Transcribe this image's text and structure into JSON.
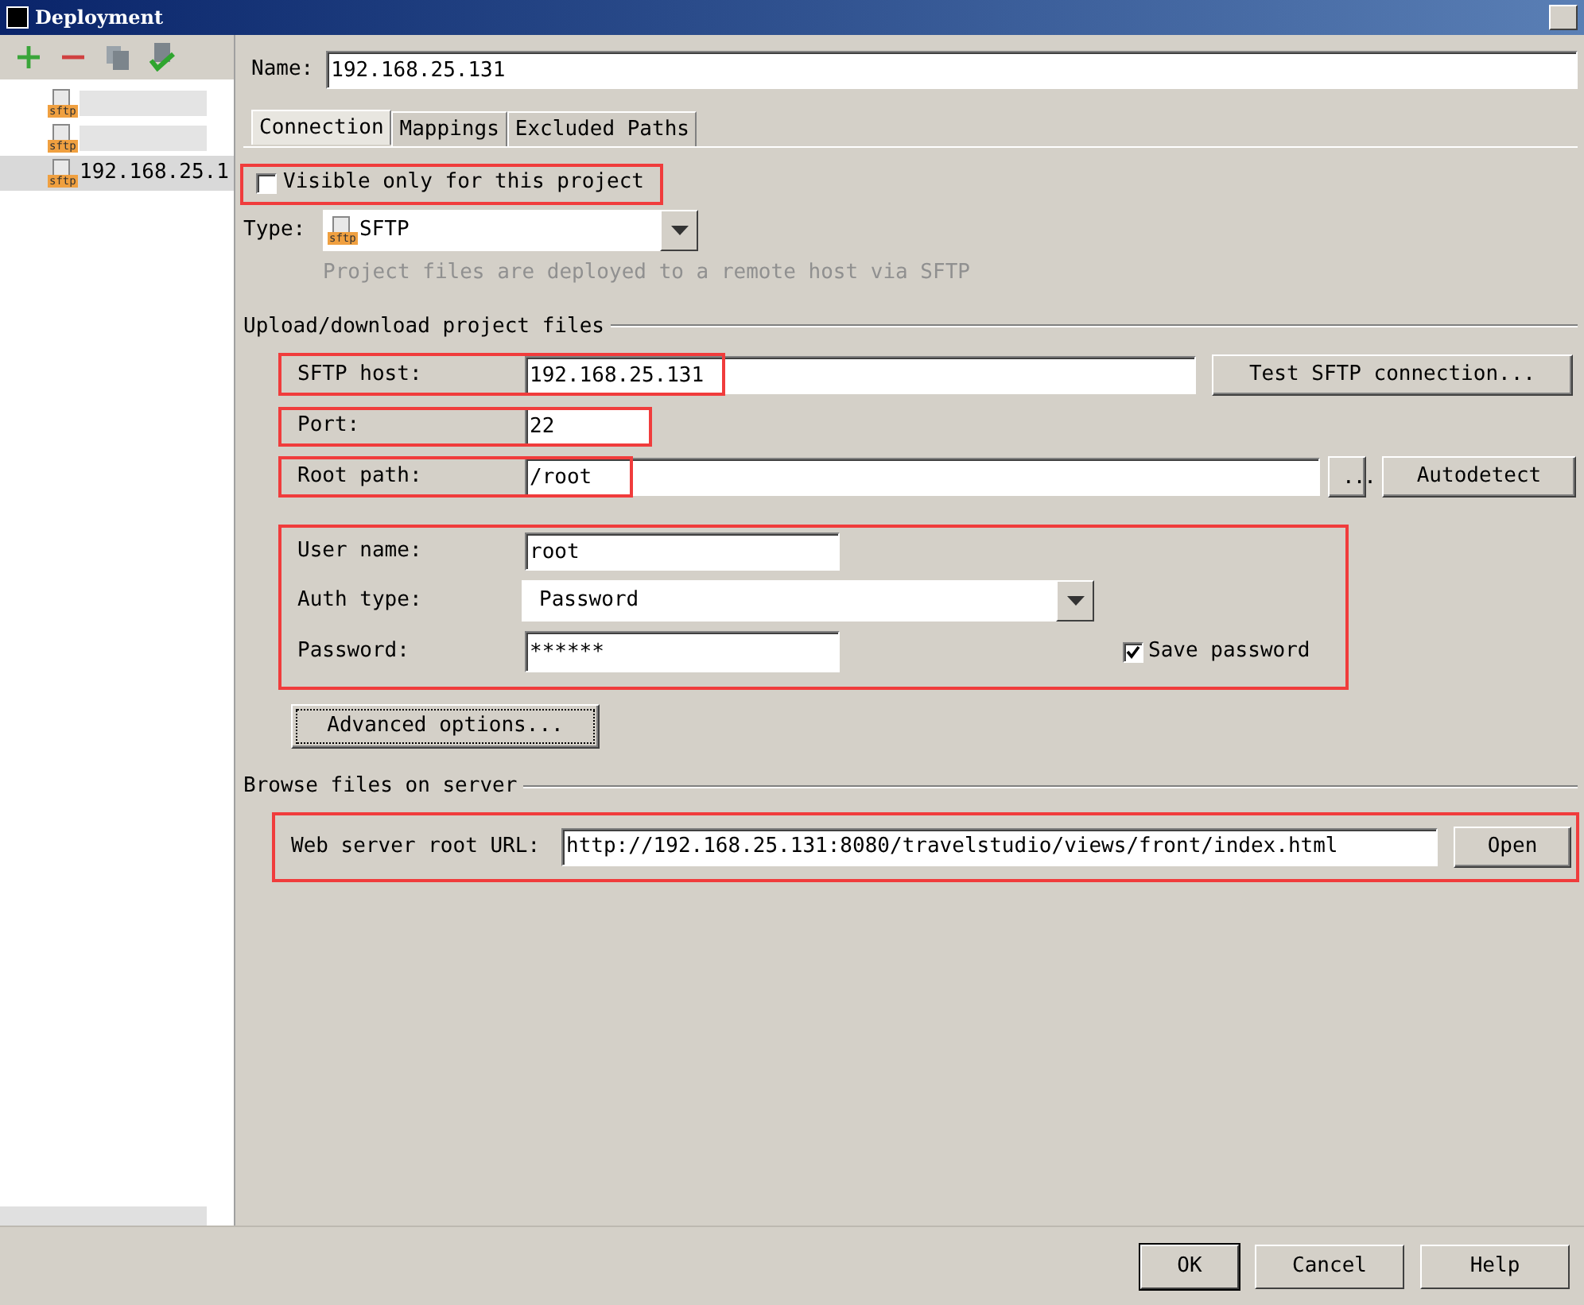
{
  "window": {
    "title": "Deployment"
  },
  "tree": [
    {
      "kind": "blurred",
      "icon_label": "sftp",
      "selected": false
    },
    {
      "kind": "blurred",
      "icon_label": "sftp",
      "selected": false
    },
    {
      "kind": "server",
      "icon_label": "sftp",
      "label": "192.168.25.1",
      "selected": true
    }
  ],
  "name": {
    "label": "Name:",
    "value": "192.168.25.131"
  },
  "tabs": [
    {
      "label": "Connection",
      "selected": true
    },
    {
      "label": "Mappings",
      "selected": false
    },
    {
      "label": "Excluded Paths",
      "selected": false
    }
  ],
  "visible_only": {
    "label": "Visible only for this project",
    "checked": false,
    "highlighted": true
  },
  "type": {
    "label": "Type:",
    "icon_label": "sftp",
    "value": "SFTP",
    "description": "Project files are deployed to a remote host via SFTP"
  },
  "upload_section": {
    "title": "Upload/download project files",
    "host": {
      "label": "SFTP host:",
      "value": "192.168.25.131",
      "button": "Test SFTP connection...",
      "highlighted": true
    },
    "port": {
      "label": "Port:",
      "value": "22",
      "highlighted": true
    },
    "root_path": {
      "label": "Root path:",
      "value": "/root",
      "browse": "...",
      "button": "Autodetect",
      "highlighted": true
    },
    "auth": {
      "highlighted": true,
      "user_label": "User name:",
      "user": "root",
      "auth_label": "Auth type:",
      "auth_type": "Password",
      "password_label": "Password:",
      "password": "******",
      "save_password": {
        "label": "Save password",
        "checked": true
      }
    },
    "advanced": "Advanced options..."
  },
  "browse_section": {
    "title": "Browse files on server",
    "web_root": {
      "label": "Web server root URL:",
      "value": "http://192.168.25.131:8080/travelstudio/views/front/index.html",
      "button": "Open",
      "highlighted": true
    }
  },
  "buttons": [
    {
      "label": "OK",
      "default": true
    },
    {
      "label": "Cancel",
      "default": false
    },
    {
      "label": "Help",
      "default": false
    }
  ]
}
